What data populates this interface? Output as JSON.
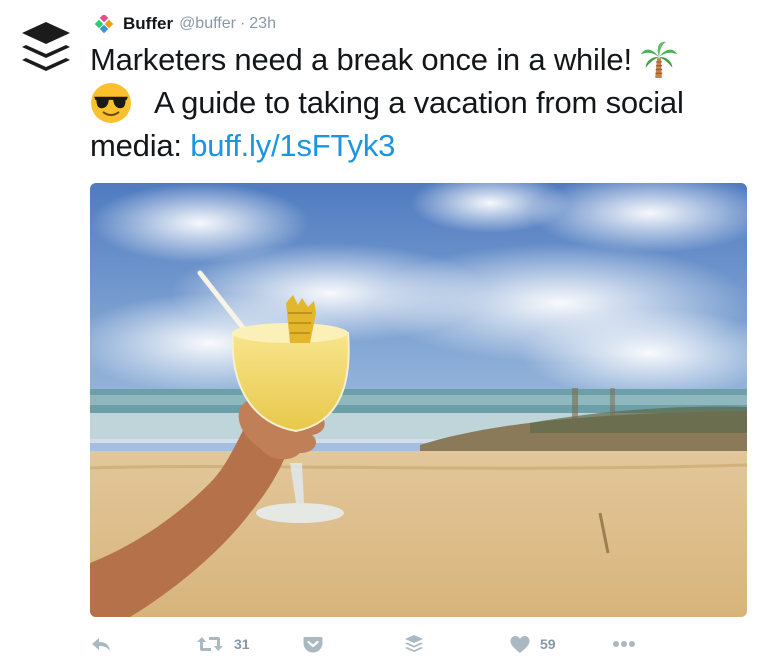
{
  "tweet": {
    "author_name": "Buffer",
    "handle": "@buffer",
    "separator": "·",
    "time": "23h",
    "text_line1": "Marketers need a break once in a while!",
    "text_line2": "A guide to taking a vacation from social",
    "text_line3_prefix": "media: ",
    "link": "buff.ly/1sFTyk3",
    "emoji_1": "palm-tree-emoji",
    "emoji_2": "sunglasses-face-emoji"
  },
  "actions": {
    "retweet_count": "31",
    "like_count": "59"
  },
  "icons": {
    "reply": "reply-icon",
    "retweet": "retweet-icon",
    "pocket": "pocket-icon",
    "buffer": "buffer-icon",
    "like": "heart-icon",
    "more": "more-icon"
  },
  "colors": {
    "link": "#1b95e0",
    "text": "#14171a",
    "muted": "#8899a6",
    "icon": "#aab8c2"
  }
}
